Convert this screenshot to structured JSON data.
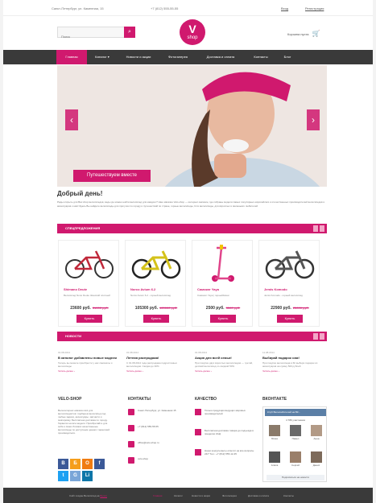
{
  "topbar": {
    "address": "Санкт-Петербург, ул. Каменная, 15",
    "phone": "+7 (812) 555-55-55",
    "login": "Вход",
    "register": "Регистрация"
  },
  "header": {
    "search_placeholder": "Поиск",
    "logo_letter": "V",
    "logo_text": "shop",
    "cart_label": "Корзина пуста"
  },
  "nav": {
    "items": [
      "Главная",
      "Каталог ▾",
      "Новости и акции",
      "Фотогалерея",
      "Доставка и оплата",
      "Контакты",
      "Блог"
    ],
    "active_index": 0
  },
  "slider": {
    "caption": "Путешествуем вместе",
    "prev": "‹",
    "next": "›"
  },
  "welcome": {
    "title": "Добрый день!",
    "text": "Рады открыть для Вас shop велосипедов, ведь где можно найти велосипед для каждого? Наш магазин Velo-shop — интернет-магазин, где собраны модели самых популярных европейских и отечественных производителей велосипедов и аксессуаров к ним! Здесь Вы найдете велосипеды для прогулок по городу и путешествий по стране, горные велосипеды, bmx велосипеды, для взрослых и маленьких любителей"
  },
  "specials": {
    "title": "СПЕЦПРЕДЛОЖЕНИЯ",
    "items": [
      {
        "name": "Shimano Deute",
        "desc": "Велосипед Nono Deute Женский плотный",
        "price": "23600 руб.",
        "old": "31000 руб.",
        "buy": "Купить"
      },
      {
        "name": "Norco Avium 6.2",
        "desc": "Norco Avium 6.2 - горный велосипед",
        "price": "105300 руб.",
        "old": "120000 руб.",
        "buy": "Купить"
      },
      {
        "name": "Самокат Yaya",
        "desc": "Самокат Yaya | горный/мини",
        "price": "2500 руб.",
        "old": "3500 руб.",
        "buy": "Купить"
      },
      {
        "name": "Jemis Komodo",
        "desc": "Jemis Komodo - горный велосипед",
        "price": "22900 руб.",
        "old": "25000 руб.",
        "buy": "Купить"
      }
    ]
  },
  "news": {
    "title": "НОВОСТИ",
    "items": [
      {
        "date": "01.08.2014",
        "title": "В каталог добавлены новые модели",
        "text": "Теперь вы можете приобрести у нас самокаты и велосипеды",
        "more": "Читать далее  ›"
      },
      {
        "date": "01.08.2014",
        "title": "Летняя распродажа!",
        "text": "С 01.08.2014 года распродажа подростковых велосипедов. Скидки до 30%",
        "more": "Читать далее  ›"
      },
      {
        "date": "01.08.2014",
        "title": "Акция для всей семьи!",
        "text": "При покупке двух взрослых велосипедов — третий, детский велосипед со скидкой 50%",
        "more": "Читать далее  ›"
      },
      {
        "date": "11.08.2014",
        "title": "Выбирай подарок сам!",
        "text": "При покупке велосипеда в 6К выбери подарок из аксессуаров на сумму 500 рублей",
        "more": "Читать далее  ›"
      }
    ]
  },
  "footer_cols": {
    "about_title": "VELO-SHOP",
    "about_text": "Велоинтернет-магазин  всё для велосипедистов: подберем велосипед под любые задачи, аксессуары, запчасти и экипировку. Бесплатная доставка по городу. Гарантия на все модели. Приобретайте для себя и своих близких качественные велосипеды по доступным ценам с гарантией производителя.",
    "contacts_title": "КОНТАКТЫ",
    "contacts": [
      "Санкт-Петербург, ул. Каменная 15",
      "+7 (812) 555-55-55",
      "office@velo-shop.ru",
      "velo-shop"
    ],
    "quality_title": "КАЧЕСТВО",
    "quality": [
      "Только продукция ведущих мировых производителей",
      "Бесплатная доставка товара до подъезда в пределах КАД",
      "Наши консультанты ответят на все вопросы 24/7 Тел.: +7 (812) 555-12-45"
    ],
    "vk_title": "ВКОНТАКТЕ",
    "vk_group": "Клуб Велолюбителей на ВК...",
    "vk_count": "4 786 участников",
    "vk_names": [
      "Юлия",
      "Павел",
      "Анна",
      "Алиса",
      "Сергей",
      "Денис"
    ],
    "vk_follow": "Подписаться на новости"
  },
  "social": [
    "В",
    "Б",
    "О",
    "f",
    "t",
    "G",
    "Li"
  ],
  "footer": {
    "copy_prefix": "Сайт создан Велосипед на ",
    "copy_link": "Велоn",
    "links": [
      "Главная",
      "Каталог",
      "Новости и акции",
      "Фотогалерея",
      "Доставка и оплата",
      "Контакты"
    ]
  },
  "colors": {
    "accent": "#d0196e",
    "dark": "#3a3a3a"
  }
}
